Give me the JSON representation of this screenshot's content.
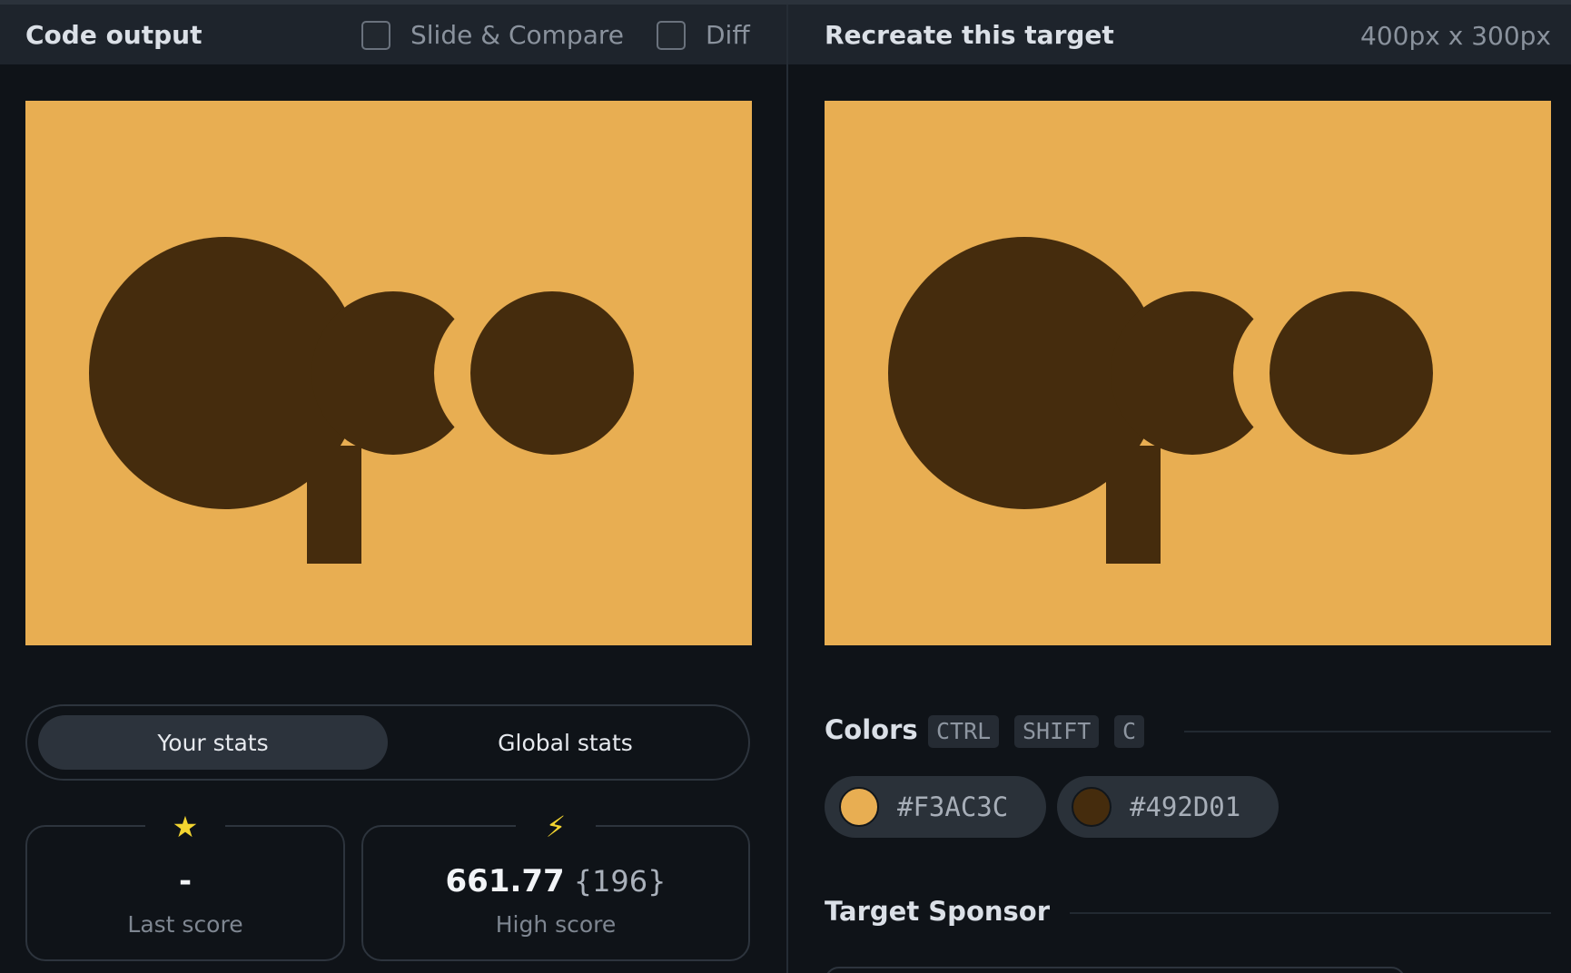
{
  "left_panel": {
    "title": "Code output",
    "slide_compare_label": "Slide & Compare",
    "diff_label": "Diff"
  },
  "right_panel": {
    "title": "Recreate this target",
    "dimensions": "400px x 300px"
  },
  "stats": {
    "tab_your": "Your stats",
    "tab_global": "Global stats",
    "last_score_value": "-",
    "last_score_label": "Last score",
    "high_score_value": "661.77",
    "high_score_count": "{196}",
    "high_score_label": "High score"
  },
  "colors": {
    "title": "Colors",
    "shortcut": [
      "CTRL",
      "SHIFT",
      "C"
    ],
    "swatches": [
      {
        "hex": "#F3AC3C"
      },
      {
        "hex": "#492D01"
      }
    ]
  },
  "sponsor": {
    "title": "Target Sponsor"
  },
  "palette": {
    "canvas_bg": "#e8ae52",
    "shape": "#452c0d",
    "swatch_1": "#e8ae52",
    "swatch_2": "#452c0d"
  }
}
